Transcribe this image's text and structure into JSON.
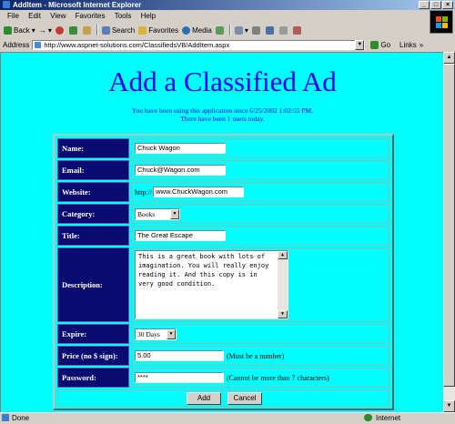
{
  "window": {
    "title": "AddItem - Microsoft Internet Explorer",
    "btn_min": "_",
    "btn_max": "□",
    "btn_close": "×"
  },
  "menu": {
    "file": "File",
    "edit": "Edit",
    "view": "View",
    "favorites": "Favorites",
    "tools": "Tools",
    "help": "Help"
  },
  "toolbar": {
    "back": "Back",
    "forward": "→",
    "search": "Search",
    "favorites": "Favorites",
    "media": "Media"
  },
  "address": {
    "label": "Address",
    "url": "http://www.aspnet-solutions.com/ClassifiedsVB/AddItem.aspx",
    "go": "Go",
    "links": "Links",
    "more": "»"
  },
  "page": {
    "title": "Add a Classified Ad",
    "info_line1": "You have been using this application since 6/25/2002 1:02:55 PM.",
    "info_line2": "There have been 1 users today."
  },
  "form": {
    "name_label": "Name:",
    "name_value": "Chuck Wagon",
    "email_label": "Email:",
    "email_value": "Chuck@Wagon.com",
    "website_label": "Website:",
    "website_prefix": "http://",
    "website_value": "www.ChuckWagon.com",
    "category_label": "Category:",
    "category_value": "Books",
    "title_label": "Title:",
    "title_value": "The Great Escape",
    "description_label": "Description:",
    "description_value": "This is a great book with lots of imagination. You will really enjoy reading it. And this copy is in very good condition.",
    "expire_label": "Expire:",
    "expire_value": "30 Days",
    "price_label": "Price (no $ sign):",
    "price_value": "5.00",
    "price_note": "(Must be a number)",
    "password_label": "Password:",
    "password_value": "****",
    "password_note": "(Cannot be more than 7 characters)",
    "add_button": "Add",
    "cancel_button": "Cancel"
  },
  "status": {
    "text": "Done",
    "zone": "Internet"
  },
  "colors": {
    "page_bg": "#00ffff",
    "label_bg": "#0a0a70",
    "title_color": "#0000ff"
  }
}
